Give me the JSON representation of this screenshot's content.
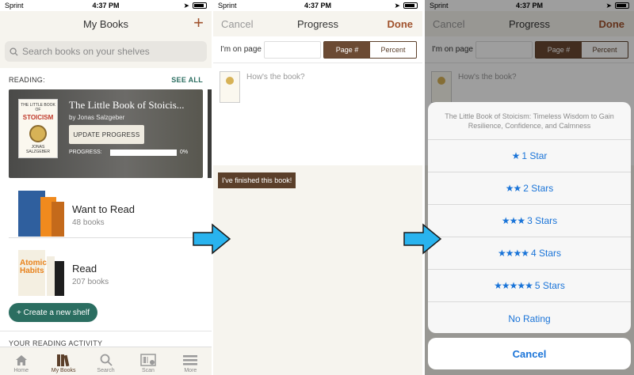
{
  "status": {
    "carrier": "Sprint",
    "time": "4:37 PM"
  },
  "screen1": {
    "title": "My Books",
    "add_label": "+",
    "search_placeholder": "Search books on your shelves",
    "reading_label": "READING:",
    "see_all": "SEE ALL",
    "current_book": {
      "title": "The Little Book of Stoicis...",
      "author": "by Jonas Salzgeber",
      "update_button": "UPDATE PROGRESS",
      "progress_label": "PROGRESS:",
      "progress_value": 0,
      "progress_text": "0%",
      "cover_small": "THE LITTLE BOOK OF",
      "cover_big": "STOICISM",
      "cover_author": "JONAS SALZGEBER"
    },
    "shelves": [
      {
        "name": "Want to Read",
        "count": "48 books"
      },
      {
        "name": "Read",
        "count": "207 books",
        "cover_text": "Atomic Habits"
      }
    ],
    "create_shelf": "+ Create a new shelf",
    "activity": "YOUR READING ACTIVITY",
    "tabs": [
      {
        "label": "Home",
        "icon": "home-icon"
      },
      {
        "label": "My Books",
        "icon": "books-icon"
      },
      {
        "label": "Search",
        "icon": "search-icon"
      },
      {
        "label": "Scan",
        "icon": "scan-icon"
      },
      {
        "label": "More",
        "icon": "menu-icon"
      }
    ]
  },
  "screen2": {
    "cancel": "Cancel",
    "title": "Progress",
    "done": "Done",
    "on_page_label": "I'm on page",
    "page_value": "",
    "seg_page": "Page #",
    "seg_percent": "Percent",
    "how_book": "How's the book?",
    "finished": "I've finished this book!"
  },
  "screen3": {
    "sheet_title": "The Little Book of Stoicism: Timeless Wisdom to Gain Resilience, Confidence, and Calmness",
    "options": [
      {
        "stars": "★",
        "label": "1 Star"
      },
      {
        "stars": "★★",
        "label": "2 Stars"
      },
      {
        "stars": "★★★",
        "label": "3 Stars"
      },
      {
        "stars": "★★★★",
        "label": "4 Stars"
      },
      {
        "stars": "★★★★★",
        "label": "5 Stars"
      },
      {
        "stars": "",
        "label": "No Rating"
      }
    ],
    "cancel": "Cancel"
  },
  "colors": {
    "accent_green": "#2b6e61",
    "brown": "#5b3f2a",
    "ios_blue": "#1a74d8",
    "arrow_blue": "#29b3ee"
  }
}
